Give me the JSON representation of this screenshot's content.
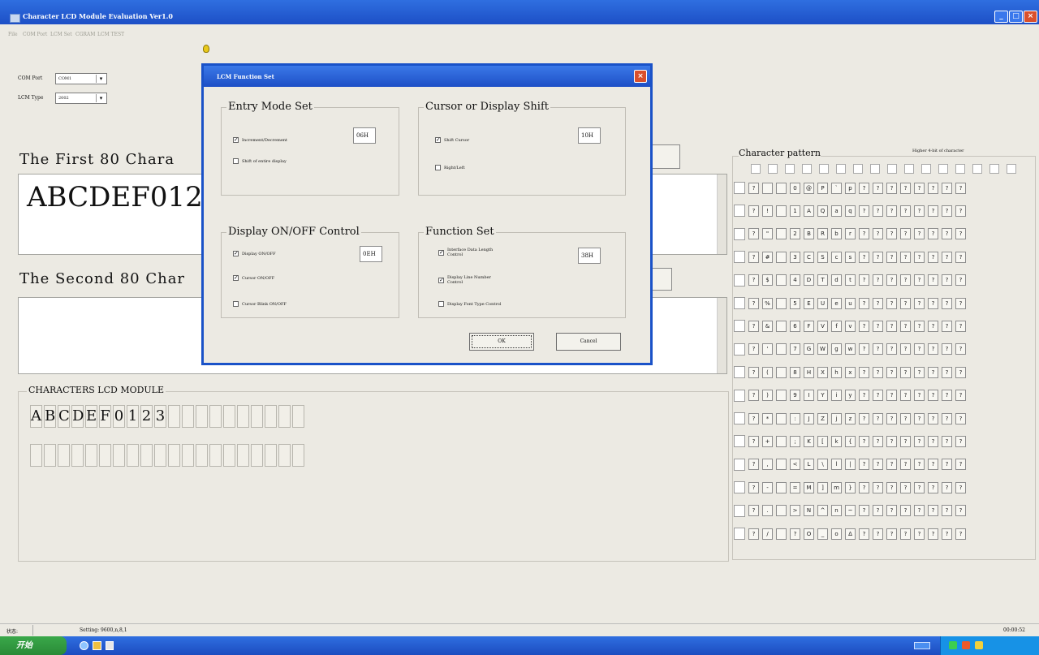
{
  "window": {
    "title": "Character LCD Module Evaluation Ver1.0"
  },
  "menu": [
    "File",
    "COM Port",
    "LCM Set",
    "CGRAM",
    "LCM TEST"
  ],
  "com_port": {
    "label": "COM Port",
    "value": "COM1"
  },
  "lcm_type": {
    "label": "LCM Type",
    "value": "2002"
  },
  "first80": {
    "label": "The First 80 Chara",
    "text": "ABCDEF0123"
  },
  "second80": {
    "label": "The Second 80 Char",
    "text": ""
  },
  "lcd_module": {
    "title": "CHARACTERS LCD MODULE",
    "row1": [
      "A",
      "B",
      "C",
      "D",
      "E",
      "F",
      "0",
      "1",
      "2",
      "3",
      "",
      "",
      "",
      "",
      "",
      "",
      "",
      "",
      "",
      ""
    ],
    "row2": [
      "",
      "",
      "",
      "",
      "",
      "",
      "",
      "",
      "",
      "",
      "",
      "",
      "",
      "",
      "",
      "",
      "",
      "",
      "",
      ""
    ]
  },
  "char_pattern": {
    "title": "Character pattern",
    "subtitle": "Higher 4-bit of character",
    "rows": [
      [
        "?",
        "",
        "",
        "0",
        "@",
        "P",
        "`",
        "p",
        "?",
        "?",
        "?",
        "?",
        "?",
        "?",
        "?",
        "?"
      ],
      [
        "?",
        "!",
        "",
        "1",
        "A",
        "Q",
        "a",
        "q",
        "?",
        "?",
        "?",
        "?",
        "?",
        "?",
        "?",
        "?"
      ],
      [
        "?",
        "\"",
        "",
        "2",
        "B",
        "R",
        "b",
        "r",
        "?",
        "?",
        "?",
        "?",
        "?",
        "?",
        "?",
        "?"
      ],
      [
        "?",
        "#",
        "",
        "3",
        "C",
        "S",
        "c",
        "s",
        "?",
        "?",
        "?",
        "?",
        "?",
        "?",
        "?",
        "?"
      ],
      [
        "?",
        "$",
        "",
        "4",
        "D",
        "T",
        "d",
        "t",
        "?",
        "?",
        "?",
        "?",
        "?",
        "?",
        "?",
        "?"
      ],
      [
        "?",
        "%",
        "",
        "5",
        "E",
        "U",
        "e",
        "u",
        "?",
        "?",
        "?",
        "?",
        "?",
        "?",
        "?",
        "?"
      ],
      [
        "?",
        "&",
        "",
        "6",
        "F",
        "V",
        "f",
        "v",
        "?",
        "?",
        "?",
        "?",
        "?",
        "?",
        "?",
        "?"
      ],
      [
        "?",
        "'",
        "",
        "7",
        "G",
        "W",
        "g",
        "w",
        "?",
        "?",
        "?",
        "?",
        "?",
        "?",
        "?",
        "?"
      ],
      [
        "?",
        "(",
        "",
        "8",
        "H",
        "X",
        "h",
        "x",
        "?",
        "?",
        "?",
        "?",
        "?",
        "?",
        "?",
        "?"
      ],
      [
        "?",
        ")",
        "",
        "9",
        "I",
        "Y",
        "i",
        "y",
        "?",
        "?",
        "?",
        "?",
        "?",
        "?",
        "?",
        "?"
      ],
      [
        "?",
        "*",
        "",
        ":",
        "J",
        "Z",
        "j",
        "z",
        "?",
        "?",
        "?",
        "?",
        "?",
        "?",
        "?",
        "?"
      ],
      [
        "?",
        "+",
        "",
        ";",
        "K",
        "[",
        "k",
        "{",
        "?",
        "?",
        "?",
        "?",
        "?",
        "?",
        "?",
        "?"
      ],
      [
        "?",
        ",",
        "",
        "<",
        "L",
        "\\",
        "l",
        "|",
        "?",
        "?",
        "?",
        "?",
        "?",
        "?",
        "?",
        "?"
      ],
      [
        "?",
        "-",
        "",
        "=",
        "M",
        "]",
        "m",
        "}",
        "?",
        "?",
        "?",
        "?",
        "?",
        "?",
        "?",
        "?"
      ],
      [
        "?",
        ".",
        "",
        ">",
        "N",
        "^",
        "n",
        "~",
        "?",
        "?",
        "?",
        "?",
        "?",
        "?",
        "?",
        "?"
      ],
      [
        "?",
        "/",
        "",
        "?",
        "O",
        "_",
        "o",
        "Δ",
        "?",
        "?",
        "?",
        "?",
        "?",
        "?",
        "?",
        "?"
      ]
    ]
  },
  "dialog": {
    "title": "LCM Function Set",
    "entry_mode": {
      "title": "Entry Mode Set",
      "hex": "06H",
      "options": [
        {
          "label": "Increment/Decrement",
          "checked": true
        },
        {
          "label": "Shift of entire display",
          "checked": false
        }
      ]
    },
    "cursor_shift": {
      "title": "Cursor or Display Shift",
      "hex": "10H",
      "options": [
        {
          "label": "Shift Cursor",
          "checked": true
        },
        {
          "label": "Right/Left",
          "checked": false
        }
      ]
    },
    "display_ctrl": {
      "title": "Display ON/OFF Control",
      "hex": "0EH",
      "options": [
        {
          "label": "Display ON/OFF",
          "checked": true
        },
        {
          "label": "Cursor ON/OFF",
          "checked": true
        },
        {
          "label": "Cursor Blink ON/OFF",
          "checked": false
        }
      ]
    },
    "function_set": {
      "title": "Function Set",
      "hex": "38H",
      "options": [
        {
          "label": "Interface Data Length Control",
          "checked": true
        },
        {
          "label": "Display Line Number Control",
          "checked": true
        },
        {
          "label": "Display Font Type Control",
          "checked": false
        }
      ]
    },
    "ok": "OK",
    "cancel": "Cancel"
  },
  "status": {
    "label": "状态:",
    "setting": "Setting: 9600,n,8,1",
    "time": "00:00:52"
  },
  "taskbar": {
    "start": "开始"
  }
}
